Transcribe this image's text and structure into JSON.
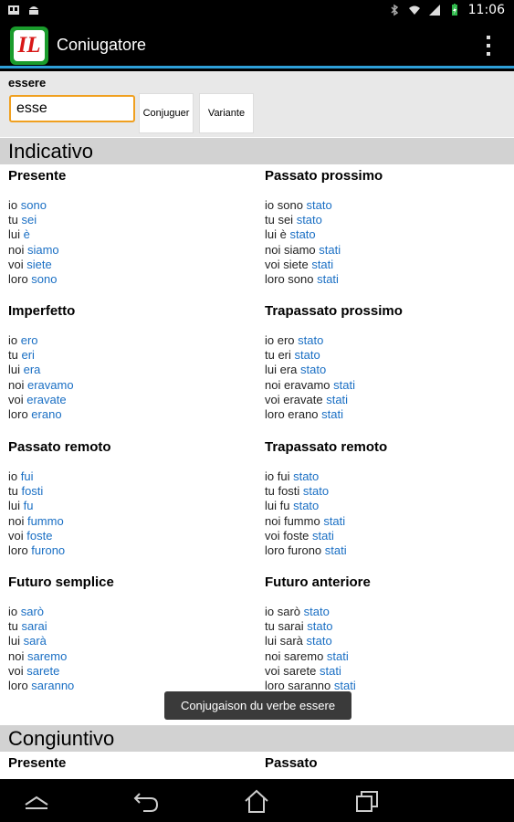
{
  "status_bar": {
    "time": "11:06"
  },
  "action_bar": {
    "icon_text": "IL",
    "title": "Coniugatore"
  },
  "input": {
    "label": "essere",
    "value": "esse",
    "conjuguer_label": "Conjuguer",
    "variante_label": "Variante"
  },
  "sections": {
    "indicativo": "Indicativo",
    "congiuntivo": "Congiuntivo"
  },
  "tenses": {
    "presente": {
      "title": "Presente",
      "lines": [
        [
          "io ",
          "sono"
        ],
        [
          "tu ",
          "sei"
        ],
        [
          "lui ",
          "è"
        ],
        [
          "noi ",
          "siamo"
        ],
        [
          "voi ",
          "siete"
        ],
        [
          "loro ",
          "sono"
        ]
      ]
    },
    "passato_prossimo": {
      "title": "Passato prossimo",
      "lines": [
        [
          "io sono ",
          "stato"
        ],
        [
          "tu sei ",
          "stato"
        ],
        [
          "lui è ",
          "stato"
        ],
        [
          "noi siamo ",
          "stati"
        ],
        [
          "voi siete ",
          "stati"
        ],
        [
          "loro sono ",
          "stati"
        ]
      ]
    },
    "imperfetto": {
      "title": "Imperfetto",
      "lines": [
        [
          "io ",
          "ero"
        ],
        [
          "tu ",
          "eri"
        ],
        [
          "lui ",
          "era"
        ],
        [
          "noi ",
          "eravamo"
        ],
        [
          "voi ",
          "eravate"
        ],
        [
          "loro ",
          "erano"
        ]
      ]
    },
    "trapassato_prossimo": {
      "title": "Trapassato prossimo",
      "lines": [
        [
          "io ero ",
          "stato"
        ],
        [
          "tu eri ",
          "stato"
        ],
        [
          "lui era ",
          "stato"
        ],
        [
          "noi eravamo ",
          "stati"
        ],
        [
          "voi eravate ",
          "stati"
        ],
        [
          "loro erano ",
          "stati"
        ]
      ]
    },
    "passato_remoto": {
      "title": "Passato remoto",
      "lines": [
        [
          "io ",
          "fui"
        ],
        [
          "tu ",
          "fosti"
        ],
        [
          "lui ",
          "fu"
        ],
        [
          "noi ",
          "fummo"
        ],
        [
          "voi ",
          "foste"
        ],
        [
          "loro ",
          "furono"
        ]
      ]
    },
    "trapassato_remoto": {
      "title": "Trapassato remoto",
      "lines": [
        [
          "io fui ",
          "stato"
        ],
        [
          "tu fosti ",
          "stato"
        ],
        [
          "lui fu ",
          "stato"
        ],
        [
          "noi fummo ",
          "stati"
        ],
        [
          "voi foste ",
          "stati"
        ],
        [
          "loro furono ",
          "stati"
        ]
      ]
    },
    "futuro_semplice": {
      "title": "Futuro semplice",
      "lines": [
        [
          "io ",
          "sarò"
        ],
        [
          "tu ",
          "sarai"
        ],
        [
          "lui ",
          "sarà"
        ],
        [
          "noi ",
          "saremo"
        ],
        [
          "voi ",
          "sarete"
        ],
        [
          "loro ",
          "saranno"
        ]
      ]
    },
    "futuro_anteriore": {
      "title": "Futuro anteriore",
      "lines": [
        [
          "io sarò ",
          "stato"
        ],
        [
          "tu sarai ",
          "stato"
        ],
        [
          "lui sarà ",
          "stato"
        ],
        [
          "noi saremo ",
          "stati"
        ],
        [
          "voi sarete ",
          "stati"
        ],
        [
          "loro saranno ",
          "stati"
        ]
      ]
    },
    "cong_presente": {
      "title": "Presente"
    },
    "cong_passato": {
      "title": "Passato"
    }
  },
  "toast": "Conjugaison du verbe essere",
  "nav": {
    "back": "back-icon",
    "home": "home-icon",
    "recents": "recents-icon",
    "up": "chevron-up-icon"
  }
}
